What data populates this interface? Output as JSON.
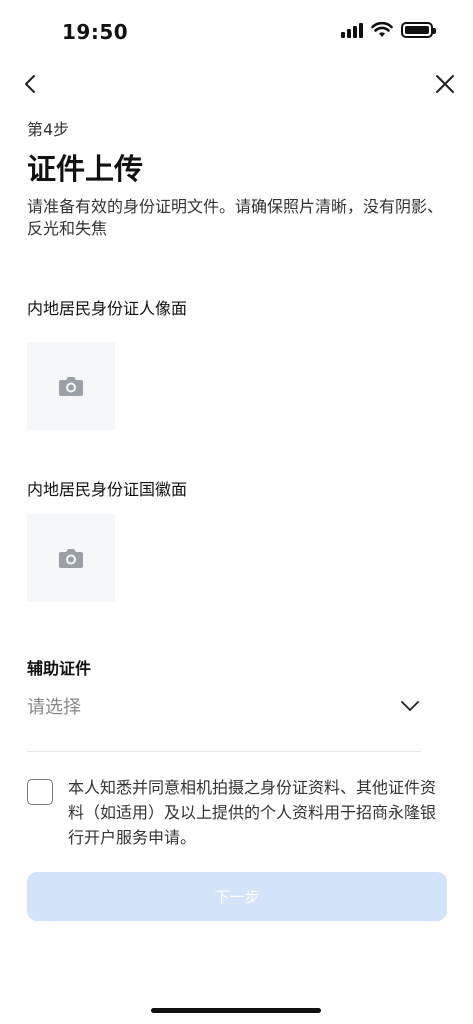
{
  "status_bar": {
    "time": "19:50"
  },
  "nav": {
    "back_icon": "chevron-left-icon",
    "close_icon": "close-icon"
  },
  "header": {
    "step": "第4步",
    "title": "证件上传",
    "description": "请准备有效的身份证明文件。请确保照片清晰，没有阴影、反光和失焦"
  },
  "uploads": [
    {
      "label": "内地居民身份证人像面",
      "icon": "camera-icon"
    },
    {
      "label": "内地居民身份证国徽面",
      "icon": "camera-icon"
    }
  ],
  "auxiliary": {
    "label": "辅助证件",
    "placeholder": "请选择",
    "icon": "chevron-down-icon"
  },
  "agreement": {
    "checked": false,
    "text": "本人知悉并同意相机拍摄之身份证资料、其他证件资料（如适用）及以上提供的个人资料用于招商永隆银行开户服务申请。"
  },
  "next_button": {
    "label": "下一步",
    "enabled": false
  },
  "colors": {
    "button_disabled_bg": "#d3e3fa",
    "upload_box_bg": "#f5f6f8",
    "placeholder_text": "#888888"
  }
}
